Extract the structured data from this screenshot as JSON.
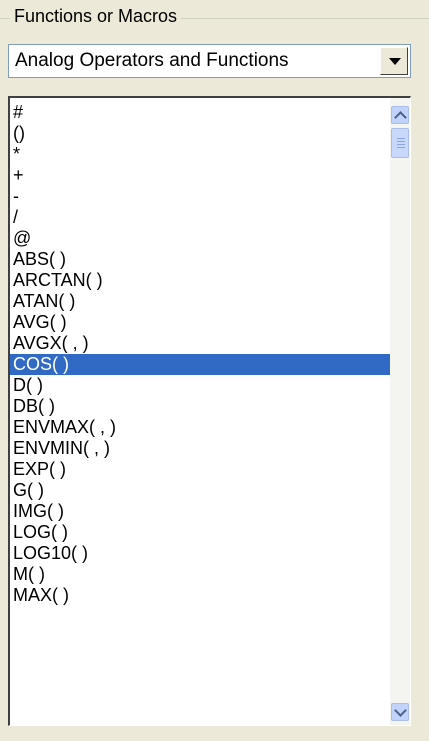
{
  "group": {
    "title": "Functions or Macros"
  },
  "combo": {
    "selected": "Analog Operators and Functions"
  },
  "list": {
    "items": [
      "#",
      "()",
      "*",
      "+",
      "-",
      "/",
      "@",
      "ABS( )",
      "ARCTAN( )",
      "ATAN( )",
      "AVG( )",
      "AVGX( , )",
      "COS( )",
      "D( )",
      "DB( )",
      "ENVMAX( , )",
      "ENVMIN( , )",
      "EXP( )",
      "G( )",
      "IMG( )",
      "LOG( )",
      "LOG10( )",
      "M( )",
      "MAX( )"
    ],
    "selected_index": 12
  },
  "colors": {
    "selection": "#316ac5",
    "window": "#ece9d8"
  },
  "icons": {
    "dropdown": "chevron-down-icon",
    "scroll_up": "scroll-up-icon",
    "scroll_down": "scroll-down-icon"
  }
}
